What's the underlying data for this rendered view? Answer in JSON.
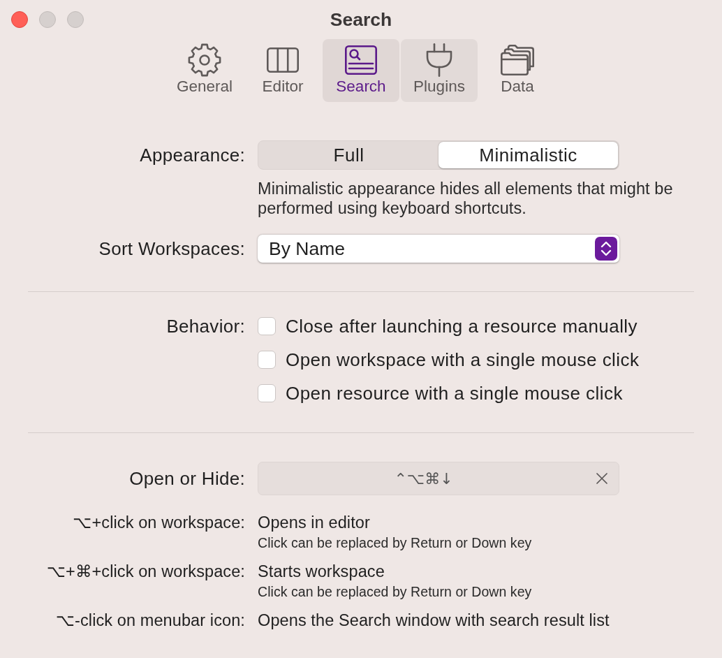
{
  "window": {
    "title": "Search",
    "buttons": [
      {
        "kind": "close",
        "disabled": false
      },
      {
        "kind": "minimize",
        "disabled": true
      },
      {
        "kind": "zoom",
        "disabled": true
      }
    ]
  },
  "toolbar": {
    "tabs": [
      {
        "label": "General",
        "selected": false,
        "hovered": false
      },
      {
        "label": "Editor",
        "selected": false,
        "hovered": false
      },
      {
        "label": "Search",
        "selected": true,
        "hovered": false
      },
      {
        "label": "Plugins",
        "selected": false,
        "hovered": true
      },
      {
        "label": "Data",
        "selected": false,
        "hovered": false
      }
    ]
  },
  "appearance": {
    "label": "Appearance:",
    "segments": [
      {
        "label": "Full",
        "selected": false
      },
      {
        "label": "Minimalistic",
        "selected": true
      }
    ],
    "description": "Minimalistic appearance hides all elements that might be performed using keyboard shortcuts."
  },
  "sort_workspaces": {
    "label": "Sort Workspaces:",
    "value": "By Name"
  },
  "behavior": {
    "label": "Behavior:",
    "options": [
      {
        "label": "Close after launching a resource manually",
        "checked": false
      },
      {
        "label": "Open workspace with a single mouse click",
        "checked": false
      },
      {
        "label": "Open resource with a single mouse click",
        "checked": false
      }
    ]
  },
  "open_or_hide": {
    "label": "Open or Hide:",
    "shortcut": "⌃⌥⌘↓"
  },
  "shortcut_hints": [
    {
      "label": "⌥+click on workspace:",
      "action": "Opens in editor",
      "note": "Click can be replaced by Return or Down key"
    },
    {
      "label": "⌥+⌘+click on workspace:",
      "action": "Starts workspace",
      "note": "Click can be replaced by Return or Down key"
    },
    {
      "label": "⌥-click on menubar icon:",
      "action": "Opens the Search window with search result list"
    }
  ]
}
